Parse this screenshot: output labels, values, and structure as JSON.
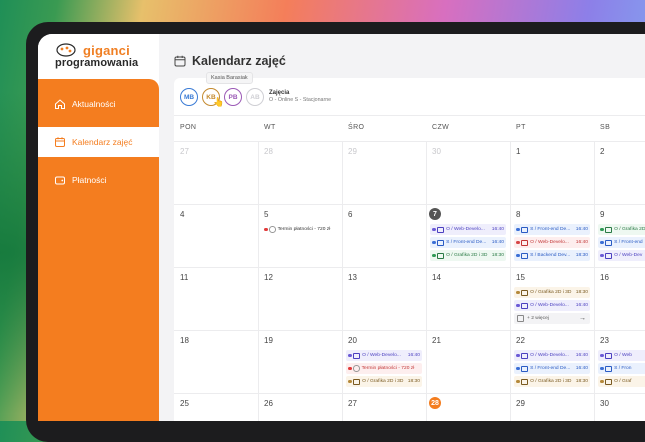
{
  "logo": {
    "line1": "giganci",
    "line2": "programowania"
  },
  "nav": [
    {
      "label": "Aktualności",
      "icon": "home-icon",
      "active": false
    },
    {
      "label": "Kalendarz zajęć",
      "icon": "calendar-icon",
      "active": true
    },
    {
      "label": "Płatności",
      "icon": "wallet-icon",
      "active": false
    }
  ],
  "page_title": "Kalendarz zajęć",
  "tooltip": "Kasia Barasiak",
  "avatars": [
    {
      "initials": "MB",
      "color": "#3a7bd5"
    },
    {
      "initials": "KB",
      "color": "#c48a2f"
    },
    {
      "initials": "PB",
      "color": "#9b59b6"
    },
    {
      "initials": "AB",
      "color": "#cfcfd4"
    }
  ],
  "legend": {
    "title": "Zajęcia",
    "subtitle": "O - Online  S - Stacjonarne"
  },
  "weekdays": [
    "PON",
    "WT",
    "ŚRO",
    "CZW",
    "PT",
    "SB"
  ],
  "weeks": [
    {
      "days": [
        {
          "num": "27",
          "dim": true
        },
        {
          "num": "28",
          "dim": true
        },
        {
          "num": "29",
          "dim": true
        },
        {
          "num": "30",
          "dim": true
        },
        {
          "num": "1",
          "dim": false
        },
        {
          "num": "2",
          "dim": false
        }
      ]
    },
    {
      "days": [
        {
          "num": "4"
        },
        {
          "num": "5"
        },
        {
          "num": "6"
        },
        {
          "num": "7",
          "badge": "#555555"
        },
        {
          "num": "8"
        },
        {
          "num": "9"
        }
      ]
    },
    {
      "days": [
        {
          "num": "11"
        },
        {
          "num": "12"
        },
        {
          "num": "13"
        },
        {
          "num": "14"
        },
        {
          "num": "15"
        },
        {
          "num": "16"
        }
      ]
    },
    {
      "days": [
        {
          "num": "18"
        },
        {
          "num": "19"
        },
        {
          "num": "20"
        },
        {
          "num": "21"
        },
        {
          "num": "22"
        },
        {
          "num": "23"
        }
      ]
    },
    {
      "days": [
        {
          "num": "25"
        },
        {
          "num": "26"
        },
        {
          "num": "27"
        },
        {
          "num": "28",
          "badge": "#f47d1f"
        },
        {
          "num": "29"
        },
        {
          "num": "30"
        }
      ]
    }
  ],
  "events": [
    {
      "week": 1,
      "day": 1,
      "slot": 0,
      "text": "Termin płatności - 720 zł",
      "time": "",
      "color": "#e23b3b",
      "bg": "#ffffff",
      "fg": "#333333",
      "kind": "pay"
    },
    {
      "week": 1,
      "day": 3,
      "slot": 0,
      "text": "O / Web-Develo...",
      "time": "16:40",
      "color": "#6b5bd6",
      "bg": "#efeefc",
      "fg": "#4b3fc0",
      "kind": "online"
    },
    {
      "week": 1,
      "day": 3,
      "slot": 1,
      "text": "S / Front-end De...",
      "time": "16:40",
      "color": "#3b6fd6",
      "bg": "#eaf1fd",
      "fg": "#2a5bc4",
      "kind": "station"
    },
    {
      "week": 1,
      "day": 3,
      "slot": 2,
      "text": "O / Grafika 2D i 3D",
      "time": "18:30",
      "color": "#2f9a55",
      "bg": "#eef8f1",
      "fg": "#2a7a45",
      "kind": "online"
    },
    {
      "week": 1,
      "day": 4,
      "slot": 0,
      "text": "S / Front-end De...",
      "time": "16:40",
      "color": "#3b6fd6",
      "bg": "#eaf1fd",
      "fg": "#2a5bc4",
      "kind": "station"
    },
    {
      "week": 1,
      "day": 4,
      "slot": 1,
      "text": "O / Web-Develo...",
      "time": "16:40",
      "color": "#d64545",
      "bg": "#fdeeee",
      "fg": "#c23535",
      "kind": "online"
    },
    {
      "week": 1,
      "day": 4,
      "slot": 2,
      "text": "S / Backend Dev...",
      "time": "18:30",
      "color": "#3b6fd6",
      "bg": "#eaf1fd",
      "fg": "#2a5bc4",
      "kind": "station"
    },
    {
      "week": 1,
      "day": 5,
      "slot": 0,
      "text": "O / Grafika 2D",
      "time": "",
      "color": "#2f9a55",
      "bg": "#eef8f1",
      "fg": "#2a7a45",
      "kind": "online"
    },
    {
      "week": 1,
      "day": 5,
      "slot": 1,
      "text": "S / Front-end",
      "time": "",
      "color": "#3b6fd6",
      "bg": "#eaf1fd",
      "fg": "#2a5bc4",
      "kind": "station"
    },
    {
      "week": 1,
      "day": 5,
      "slot": 2,
      "text": "O / Web-Dev",
      "time": "",
      "color": "#6b5bd6",
      "bg": "#efeefc",
      "fg": "#4b3fc0",
      "kind": "online"
    },
    {
      "week": 2,
      "day": 4,
      "slot": 0,
      "text": "O / Grafika 2D i 3D",
      "time": "18:30",
      "color": "#b5893a",
      "bg": "#fbf4e8",
      "fg": "#7a5a20",
      "kind": "online"
    },
    {
      "week": 2,
      "day": 4,
      "slot": 1,
      "text": "O / Web-Develo...",
      "time": "16:40",
      "color": "#6b5bd6",
      "bg": "#efeefc",
      "fg": "#4b3fc0",
      "kind": "online"
    },
    {
      "week": 3,
      "day": 2,
      "slot": 0,
      "text": "O / Web-Develo...",
      "time": "16:40",
      "color": "#6b5bd6",
      "bg": "#efeefc",
      "fg": "#4b3fc0",
      "kind": "online"
    },
    {
      "week": 3,
      "day": 2,
      "slot": 1,
      "text": "Termin płatności - 720 zł",
      "time": "",
      "color": "#e23b3b",
      "bg": "#fdeeee",
      "fg": "#c23535",
      "kind": "pay"
    },
    {
      "week": 3,
      "day": 2,
      "slot": 2,
      "text": "O / Grafika 2D i 3D",
      "time": "18:30",
      "color": "#b5893a",
      "bg": "#fbf4e8",
      "fg": "#7a5a20",
      "kind": "online"
    },
    {
      "week": 3,
      "day": 4,
      "slot": 0,
      "text": "O / Web-Develo...",
      "time": "16:40",
      "color": "#6b5bd6",
      "bg": "#efeefc",
      "fg": "#4b3fc0",
      "kind": "online"
    },
    {
      "week": 3,
      "day": 4,
      "slot": 1,
      "text": "S / Front-end De...",
      "time": "16:40",
      "color": "#3b6fd6",
      "bg": "#eaf1fd",
      "fg": "#2a5bc4",
      "kind": "station"
    },
    {
      "week": 3,
      "day": 4,
      "slot": 2,
      "text": "O / Grafika 2D i 3D",
      "time": "18:30",
      "color": "#b5893a",
      "bg": "#fbf4e8",
      "fg": "#7a5a20",
      "kind": "online"
    },
    {
      "week": 3,
      "day": 5,
      "slot": 0,
      "text": "O / Web",
      "time": "",
      "color": "#6b5bd6",
      "bg": "#efeefc",
      "fg": "#4b3fc0",
      "kind": "online"
    },
    {
      "week": 3,
      "day": 5,
      "slot": 1,
      "text": "S / Fron",
      "time": "",
      "color": "#3b6fd6",
      "bg": "#eaf1fd",
      "fg": "#2a5bc4",
      "kind": "station"
    },
    {
      "week": 3,
      "day": 5,
      "slot": 2,
      "text": "O / Graf",
      "time": "",
      "color": "#b5893a",
      "bg": "#fbf4e8",
      "fg": "#7a5a20",
      "kind": "online"
    }
  ],
  "more": {
    "week": 2,
    "day": 4,
    "slot": 2,
    "text": "+ 2 więcej"
  }
}
